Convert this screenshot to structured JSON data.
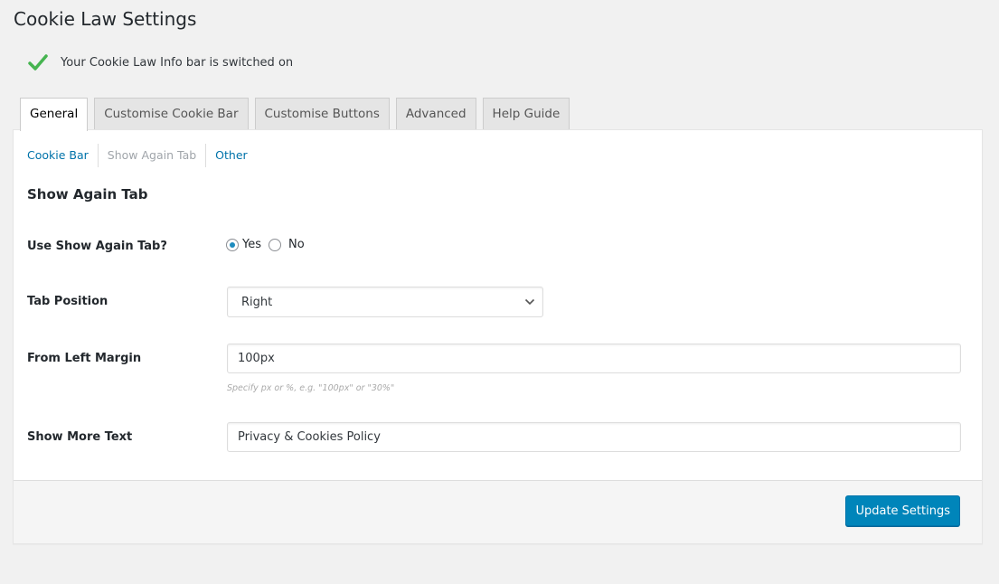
{
  "page": {
    "title": "Cookie Law Settings"
  },
  "notice": {
    "icon": "check-icon",
    "message": "Your Cookie Law Info bar is switched on",
    "icon_color": "#46b450"
  },
  "tabs": [
    {
      "label": "General",
      "active": true
    },
    {
      "label": "Customise Cookie Bar",
      "active": false
    },
    {
      "label": "Customise Buttons",
      "active": false
    },
    {
      "label": "Advanced",
      "active": false
    },
    {
      "label": "Help Guide",
      "active": false
    }
  ],
  "subnav": [
    {
      "label": "Cookie Bar",
      "current": false
    },
    {
      "label": "Show Again Tab",
      "current": true
    },
    {
      "label": "Other",
      "current": false
    }
  ],
  "section": {
    "title": "Show Again Tab"
  },
  "fields": {
    "use_show_again": {
      "label": "Use Show Again Tab?",
      "options": [
        "Yes",
        "No"
      ],
      "selected": "Yes"
    },
    "tab_position": {
      "label": "Tab Position",
      "selected": "Right"
    },
    "left_margin": {
      "label": "From Left Margin",
      "value": "100px",
      "hint": "Specify px or %, e.g. \"100px\" or \"30%\""
    },
    "show_more_text": {
      "label": "Show More Text",
      "value": "Privacy & Cookies Policy"
    }
  },
  "footer": {
    "submit_label": "Update Settings"
  },
  "colors": {
    "link": "#0073aa",
    "primary_button": "#0085ba",
    "radio_checked": "#1e8cbe"
  }
}
